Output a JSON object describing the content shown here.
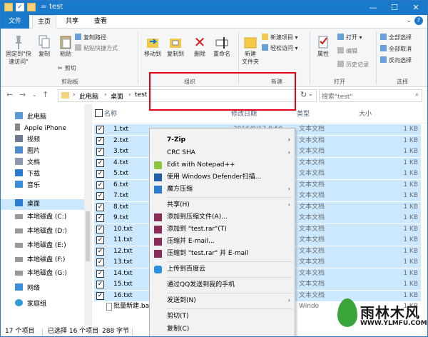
{
  "window": {
    "title": "test",
    "title_prefix": "|",
    "quick_access_eq": "=",
    "buttons": {
      "minimize": "—",
      "maximize": "☐",
      "close": "✕"
    }
  },
  "tabs": [
    "文件",
    "主页",
    "共享",
    "查看"
  ],
  "ribbon": {
    "clipboard": {
      "pin": "固定到\"快",
      "pin2": "速访问\"",
      "copy": "复制",
      "paste": "粘贴",
      "copy_path": "复制路径",
      "paste_shortcut": "粘贴快捷方式",
      "cut": "剪切",
      "group": "剪贴板"
    },
    "organize": {
      "move_to": "移动到",
      "copy_to": "复制到",
      "delete": "删除",
      "rename": "重命名",
      "group": "组织"
    },
    "new": {
      "new_folder1": "新建",
      "new_folder2": "文件夹",
      "new_item": "新建项目",
      "easy_access": "轻松访问",
      "group": "新建"
    },
    "open": {
      "properties": "属性",
      "open": "打开",
      "edit": "编辑",
      "history": "历史记录",
      "group": "打开"
    },
    "select": {
      "select_all": "全部选择",
      "select_none": "全部取消",
      "invert": "反向选择",
      "group": "选择"
    }
  },
  "address": {
    "crumbs": [
      "此电脑",
      "桌面",
      "test"
    ],
    "search_placeholder": "搜索\"test\""
  },
  "nav_pane": [
    {
      "label": "此电脑",
      "icon": "computer-icon"
    },
    {
      "label": "Apple iPhone",
      "icon": "phone-icon"
    },
    {
      "label": "视频",
      "icon": "video-folder-icon"
    },
    {
      "label": "图片",
      "icon": "picture-folder-icon"
    },
    {
      "label": "文档",
      "icon": "document-folder-icon"
    },
    {
      "label": "下载",
      "icon": "download-folder-icon"
    },
    {
      "label": "音乐",
      "icon": "music-folder-icon"
    },
    {
      "label": "桌面",
      "icon": "desktop-folder-icon",
      "selected": true
    },
    {
      "label": "本地磁盘 (C:)",
      "icon": "drive-icon"
    },
    {
      "label": "本地磁盘 (D:)",
      "icon": "drive-icon"
    },
    {
      "label": "本地磁盘 (E:)",
      "icon": "drive-icon"
    },
    {
      "label": "本地磁盘 (F:)",
      "icon": "drive-icon"
    },
    {
      "label": "本地磁盘 (G:)",
      "icon": "drive-icon"
    },
    {
      "label": "网络",
      "icon": "network-icon"
    },
    {
      "label": "家庭组",
      "icon": "homegroup-icon"
    }
  ],
  "columns": {
    "name": "名称",
    "date": "修改日期",
    "type": "类型",
    "size": "大小"
  },
  "files": [
    {
      "name": "1.txt",
      "date": "2016/8/17 8:50",
      "type": "文本文档",
      "size": "1 KB"
    },
    {
      "name": "2.txt",
      "date": "",
      "type": "文本文档",
      "size": "1 KB"
    },
    {
      "name": "3.txt",
      "date": "",
      "type": "文本文档",
      "size": "1 KB"
    },
    {
      "name": "4.txt",
      "date": "",
      "type": "文本文档",
      "size": "1 KB"
    },
    {
      "name": "5.txt",
      "date": "",
      "type": "文本文档",
      "size": "1 KB"
    },
    {
      "name": "6.txt",
      "date": "",
      "type": "文本文档",
      "size": "1 KB"
    },
    {
      "name": "7.txt",
      "date": "",
      "type": "文本文档",
      "size": "1 KB"
    },
    {
      "name": "8.txt",
      "date": "",
      "type": "文本文档",
      "size": "1 KB"
    },
    {
      "name": "9.txt",
      "date": "",
      "type": "文本文档",
      "size": "1 KB"
    },
    {
      "name": "10.txt",
      "date": "",
      "type": "文本文档",
      "size": "1 KB"
    },
    {
      "name": "11.txt",
      "date": "",
      "type": "文本文档",
      "size": "1 KB"
    },
    {
      "name": "12.txt",
      "date": "",
      "type": "文本文档",
      "size": "1 KB"
    },
    {
      "name": "13.txt",
      "date": "",
      "type": "文本文档",
      "size": "1 KB"
    },
    {
      "name": "14.txt",
      "date": "",
      "type": "文本文档",
      "size": "1 KB"
    },
    {
      "name": "15.txt",
      "date": "",
      "type": "文本文档",
      "size": "1 KB"
    },
    {
      "name": "16.txt",
      "date": "",
      "type": "文本文档",
      "size": "1 KB"
    }
  ],
  "extra_file": {
    "name": "批量新建.ba",
    "type": "Windo",
    "size": "1 KB"
  },
  "context_menu": [
    {
      "label": "7-Zip",
      "bold": true,
      "submenu": true
    },
    {
      "label": "CRC SHA",
      "submenu": true
    },
    {
      "label": "Edit with Notepad++",
      "icon": "notepad-icon"
    },
    {
      "label": "使用 Windows Defender扫描...",
      "icon": "defender-icon"
    },
    {
      "label": "魔方压缩",
      "icon": "cube-icon",
      "submenu": true
    },
    {
      "label": "共享(H)",
      "submenu": true
    },
    {
      "label": "添加到压缩文件(A)...",
      "icon": "rar-icon"
    },
    {
      "label": "添加到 \"test.rar\"(T)",
      "icon": "rar-icon"
    },
    {
      "label": "压缩并 E-mail...",
      "icon": "rar-icon"
    },
    {
      "label": "压缩到 \"test.rar\" 并 E-mail",
      "icon": "rar-icon"
    },
    {
      "label": "上传到百度云",
      "icon": "baidu-cloud-icon"
    },
    {
      "label": "通过QQ发送到我的手机"
    },
    {
      "label": "发送到(N)",
      "submenu": true
    },
    {
      "label": "剪切(T)"
    },
    {
      "label": "复制(C)"
    }
  ],
  "status": {
    "count": "17 个项目",
    "selected": "已选择 16 个项目",
    "size": "288 字节"
  },
  "watermark": {
    "text": "雨林木风",
    "url": "WWW.YLMFU.COM"
  },
  "colors": {
    "accent": "#1979ca",
    "selection": "#cce8ff",
    "highlight_box": "#e60012"
  }
}
